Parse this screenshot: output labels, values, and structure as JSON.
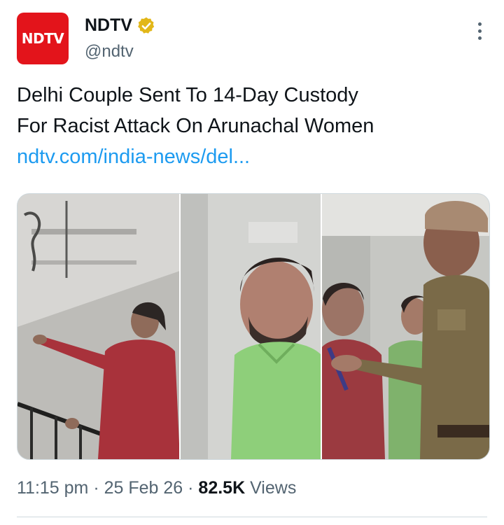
{
  "author": {
    "avatar_text": "NDTV",
    "display_name": "NDTV",
    "handle": "@ndtv",
    "verified_color": "#e2b719",
    "brand_color": "#e3141b"
  },
  "tweet": {
    "line1": "Delhi Couple Sent To 14-Day Custody",
    "line2": "For Racist Attack On Arunachal Women",
    "link": "ndtv.com/india-news/del..."
  },
  "meta": {
    "time": "11:15 pm",
    "sep1": " · ",
    "date": "25 Feb 26",
    "sep2": " · ",
    "views_count": "82.5K",
    "views_label": " Views"
  },
  "icons": {
    "verified": "verified-badge-icon",
    "more": "more-options-icon"
  }
}
